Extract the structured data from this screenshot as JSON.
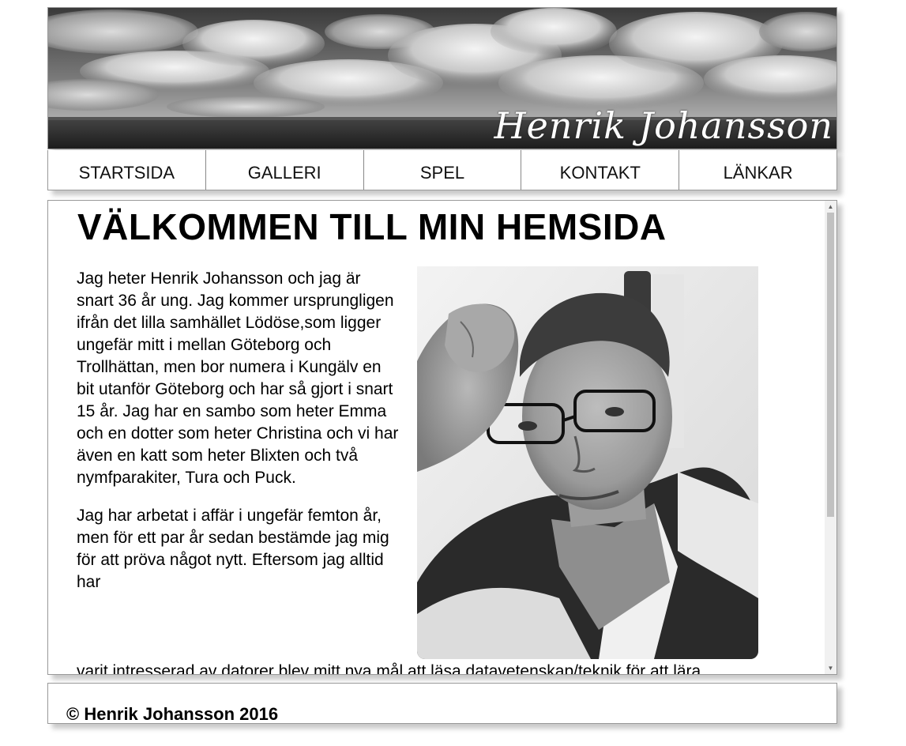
{
  "header": {
    "site_name": "Henrik Johansson"
  },
  "nav": {
    "items": [
      {
        "label": "STARTSIDA"
      },
      {
        "label": "GALLERI"
      },
      {
        "label": "SPEL"
      },
      {
        "label": "KONTAKT"
      },
      {
        "label": "LÄNKAR"
      }
    ]
  },
  "main": {
    "heading": "VÄLKOMMEN TILL MIN HEMSIDA",
    "paragraph1": "Jag heter Henrik Johansson och jag är snart 36 år ung. Jag kommer ursprungligen ifrån det lilla samhället Lödöse,som ligger ungefär mitt i mellan Göteborg och Trollhättan, men bor numera i Kungälv en bit utanför Göteborg och har så gjort i snart 15 år. Jag har en sambo som heter Emma och en dotter som heter Christina och vi har även en katt som heter Blixten och två nymfparakiter, Tura och Puck.",
    "paragraph2": "Jag har arbetat i affär i ungefär femton år, men för ett par år sedan bestämde jag mig för att pröva något nytt. Eftersom jag alltid har",
    "paragraph2_continued": "varit intresserad av datorer blev mitt nya mål att läsa datavetenskap/teknik för att lära",
    "photo_icon": "portrait-photo"
  },
  "footer": {
    "copyright": "© Henrik Johansson 2016"
  },
  "colors": {
    "border": "#999999",
    "shadow": "#c8c8c8",
    "text": "#000000",
    "background": "#ffffff"
  }
}
